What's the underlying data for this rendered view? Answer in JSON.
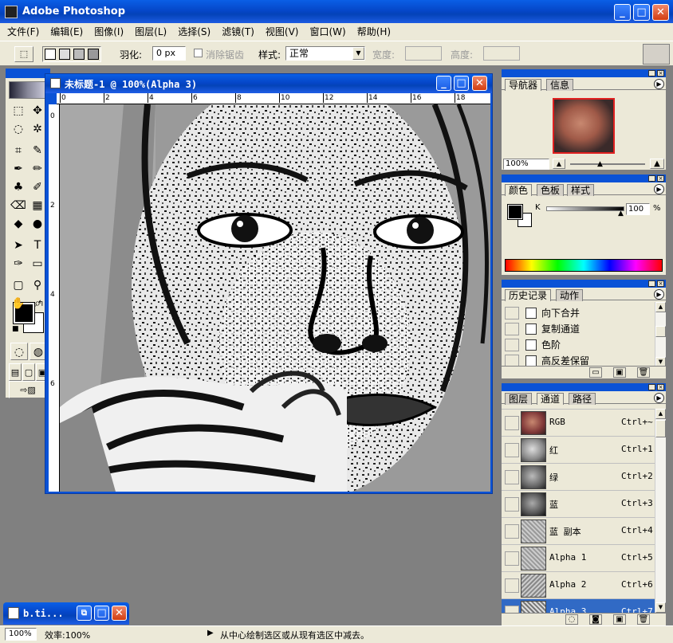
{
  "app": {
    "title": "Adobe Photoshop"
  },
  "menu": [
    "文件(F)",
    "编辑(E)",
    "图像(I)",
    "图层(L)",
    "选择(S)",
    "滤镜(T)",
    "视图(V)",
    "窗口(W)",
    "帮助(H)"
  ],
  "options": {
    "feather_label": "羽化:",
    "feather_value": "0 px",
    "antialias_label": "消除锯齿",
    "style_label": "样式:",
    "style_value": "正常",
    "width_label": "宽度:",
    "height_label": "高度:"
  },
  "document": {
    "title": "未标题-1 @ 100%(Alpha 3)",
    "ruler_h": [
      "0",
      "2",
      "4",
      "6",
      "8",
      "10",
      "12",
      "14",
      "16",
      "18"
    ],
    "ruler_v": [
      "0",
      "2",
      "4",
      "6"
    ]
  },
  "navigator": {
    "tabs": [
      "导航器",
      "信息"
    ],
    "zoom": "100%"
  },
  "color": {
    "tabs": [
      "颜色",
      "色板",
      "样式"
    ],
    "channel": "K",
    "value": "100",
    "unit": "%"
  },
  "history": {
    "tabs": [
      "历史记录",
      "动作"
    ],
    "items": [
      "向下合并",
      "复制通道",
      "色阶",
      "高反差保留"
    ]
  },
  "channels": {
    "tabs": [
      "图层",
      "通道",
      "路径"
    ],
    "items": [
      {
        "name": "RGB",
        "shortcut": "Ctrl+~"
      },
      {
        "name": "红",
        "shortcut": "Ctrl+1"
      },
      {
        "name": "绿",
        "shortcut": "Ctrl+2"
      },
      {
        "name": "蓝",
        "shortcut": "Ctrl+3"
      },
      {
        "name": "蓝 副本",
        "shortcut": "Ctrl+4"
      },
      {
        "name": "Alpha 1",
        "shortcut": "Ctrl+5"
      },
      {
        "name": "Alpha 2",
        "shortcut": "Ctrl+6"
      },
      {
        "name": "Alpha 3",
        "shortcut": "Ctrl+7"
      }
    ]
  },
  "minimized": {
    "title": "b.ti..."
  },
  "status": {
    "zoom": "100%",
    "efficiency": "效率:100%",
    "hint": "从中心绘制选区或从现有选区中减去。"
  }
}
